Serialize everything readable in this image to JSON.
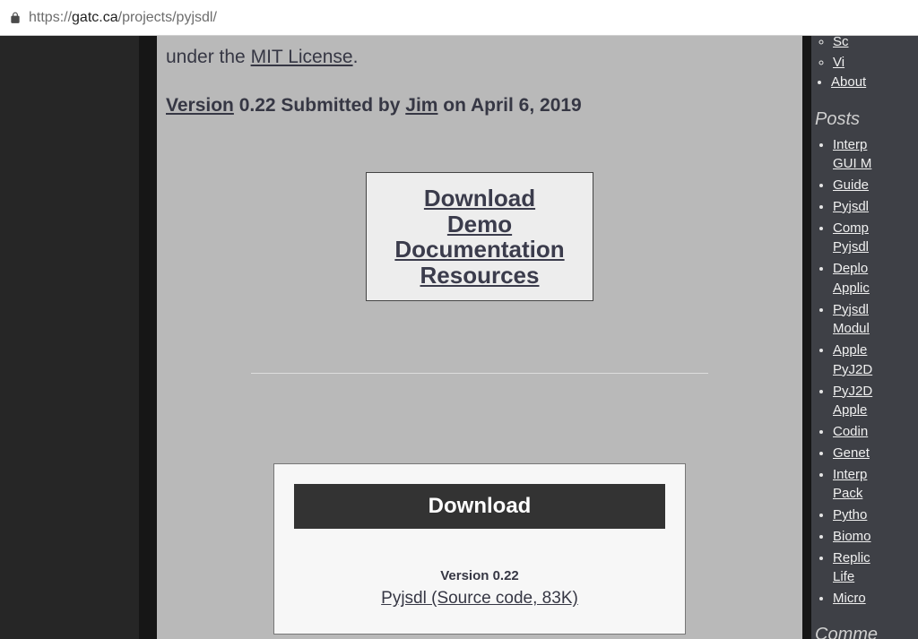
{
  "browser": {
    "url_prefix": "https://",
    "url_domain": "gatc.ca",
    "url_path": "/projects/pyjsdl/"
  },
  "content": {
    "intro_fragment_prefix": "under the ",
    "intro_fragment_link": "MIT License",
    "intro_fragment_suffix": ".",
    "submission": {
      "version_link": "Version",
      "version_text": " 0.22 Submitted by ",
      "author_link": "Jim",
      "date_text": " on April 6, 2019"
    },
    "toc": {
      "download": "Download",
      "demo": "Demo",
      "documentation": "Documentation",
      "resources": "Resources"
    },
    "download_box": {
      "header": "Download",
      "version": "Version 0.22",
      "link": "Pyjsdl (Source code, 83K)"
    }
  },
  "sidebar": {
    "nav_subitems": [
      "Sc",
      "Vi"
    ],
    "nav_last": "About",
    "posts_header": "Posts",
    "posts": [
      "Interp",
      "GUI M",
      "Guide",
      "Pyjsdl",
      "Comp",
      "Pyjsdl",
      "Deplo",
      "Applic",
      "Pyjsdl",
      "Modul",
      "Apple",
      "PyJ2D",
      "PyJ2D",
      "Apple",
      "Codin",
      "Genet",
      "Interp",
      "Pack",
      "Pytho",
      "Biomo",
      "Replic",
      "Life",
      "Micro"
    ],
    "comments_header": "Comme"
  }
}
